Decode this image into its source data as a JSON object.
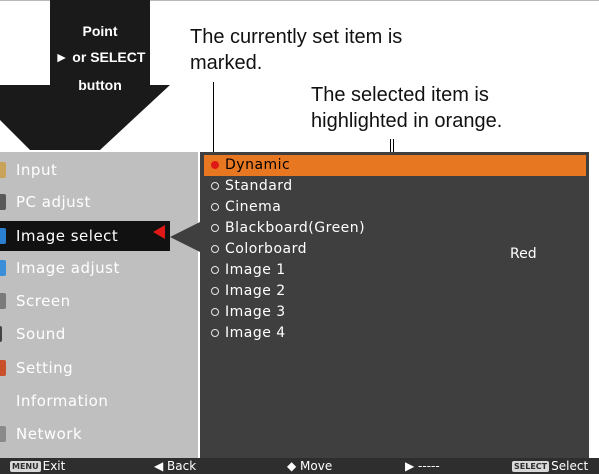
{
  "arrow": {
    "line1": "Point",
    "line2": "► or SELECT",
    "line3": "button"
  },
  "annotations": {
    "current_set": "The currently set item is marked.",
    "current_set_l1": "The currently set item is",
    "current_set_l2": "marked.",
    "selected_l1": "The selected item is",
    "selected_l2": "highlighted in orange."
  },
  "menu": {
    "left_items": [
      {
        "label": "Input",
        "icon": "input-icon"
      },
      {
        "label": "PC adjust",
        "icon": "pc-adjust-icon"
      },
      {
        "label": "Image select",
        "icon": "image-select-icon"
      },
      {
        "label": "Image adjust",
        "icon": "image-adjust-icon"
      },
      {
        "label": "Screen",
        "icon": "screen-icon"
      },
      {
        "label": "Sound",
        "icon": "sound-icon"
      },
      {
        "label": "Setting",
        "icon": "setting-icon"
      },
      {
        "label": "Information",
        "icon": ""
      },
      {
        "label": "Network",
        "icon": "network-icon"
      }
    ],
    "active_index": 2,
    "right_items": [
      {
        "label": "Dynamic",
        "set": true,
        "highlighted": true
      },
      {
        "label": "Standard"
      },
      {
        "label": "Cinema"
      },
      {
        "label": "Blackboard(Green)"
      },
      {
        "label": "Colorboard"
      },
      {
        "label": "Image 1"
      },
      {
        "label": "Image 2"
      },
      {
        "label": "Image 3"
      },
      {
        "label": "Image 4"
      }
    ],
    "colorboard_value": "Red"
  },
  "bottom_bar": {
    "exit_key": "MENU",
    "exit": "Exit",
    "back": "◀ Back",
    "move": "◆ Move",
    "next": "▶ -----",
    "select_key": "SELECT",
    "select": "Select"
  },
  "colors": {
    "highlight": "#e87722",
    "marker": "#e01818",
    "panel_left": "#bfbfbf",
    "panel_right": "#3f3f3f"
  }
}
